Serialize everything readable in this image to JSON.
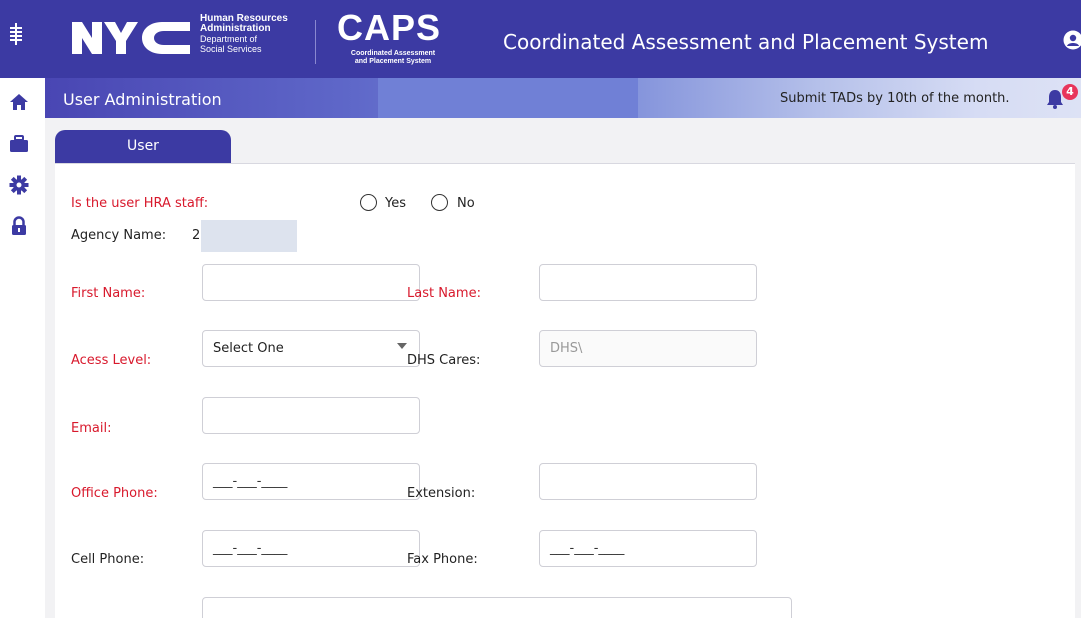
{
  "header": {
    "hra_line1": "Human Resources",
    "hra_line2": "Administration",
    "hra_line3": "Department of",
    "hra_line4": "Social Services",
    "caps_title": "CAPS",
    "caps_sub1": "Coordinated Assessment",
    "caps_sub2": "and Placement System",
    "app_title": "Coordinated Assessment and Placement System"
  },
  "subbar": {
    "title": "User Administration",
    "notice": "Submit TADs by 10th of the month.",
    "notification_count": "4"
  },
  "tab": {
    "label": "User"
  },
  "form": {
    "hra_staff": {
      "label": "Is the user HRA staff:",
      "yes": "Yes",
      "no": "No"
    },
    "agency": {
      "label": "Agency Name:",
      "value": "2"
    },
    "first_name": {
      "label": "First Name:",
      "value": ""
    },
    "last_name": {
      "label": "Last Name:",
      "value": ""
    },
    "access_level": {
      "label": "Acess Level:",
      "selected": "Select One"
    },
    "dhs_cares": {
      "label": "DHS Cares:",
      "value": "DHS\\"
    },
    "email": {
      "label": "Email:",
      "value": ""
    },
    "office_phone": {
      "label": "Office Phone:",
      "mask": "___-___-____"
    },
    "extension": {
      "label": "Extension:",
      "value": ""
    },
    "cell_phone": {
      "label": "Cell Phone:",
      "mask": "___-___-____"
    },
    "fax_phone": {
      "label": "Fax Phone:",
      "mask": "___-___-____"
    }
  },
  "colors": {
    "brand": "#3c3aa3",
    "required": "#d8192c",
    "badge": "#e8355b"
  },
  "icons": [
    "menu-icon",
    "home-icon",
    "briefcase-icon",
    "gear-icon",
    "lock-icon",
    "user-circle-icon",
    "bell-icon"
  ]
}
